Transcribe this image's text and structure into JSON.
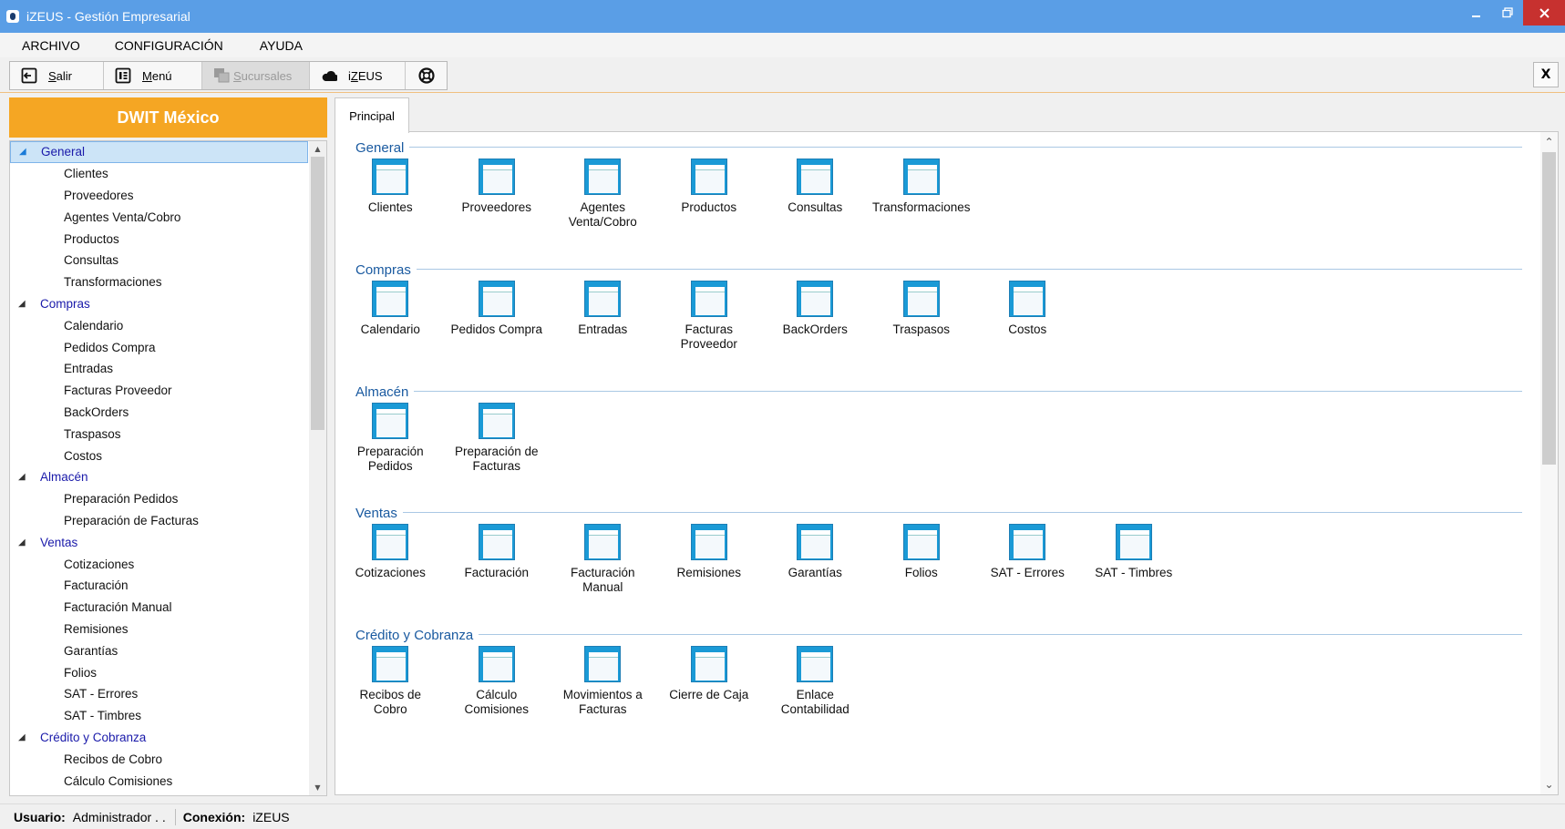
{
  "window": {
    "title": "iZEUS - Gestión Empresarial"
  },
  "menu": [
    "ARCHIVO",
    "CONFIGURACIÓN",
    "AYUDA"
  ],
  "toolbar": {
    "salir_u": "S",
    "salir_rest": "alir",
    "menu_u": "M",
    "menu_rest": "enú",
    "sucursales_u": "S",
    "sucursales_rest": "ucursales",
    "izeus_pre": "i",
    "izeus_u": "Z",
    "izeus_rest": "EUS",
    "close": "X"
  },
  "sidebar": {
    "company": "DWIT México",
    "tree": [
      {
        "label": "General",
        "children": [
          "Clientes",
          "Proveedores",
          "Agentes Venta/Cobro",
          "Productos",
          "Consultas",
          "Transformaciones"
        ]
      },
      {
        "label": "Compras",
        "children": [
          "Calendario",
          "Pedidos Compra",
          "Entradas",
          "Facturas Proveedor",
          "BackOrders",
          "Traspasos",
          "Costos"
        ]
      },
      {
        "label": "Almacén",
        "children": [
          "Preparación Pedidos",
          "Preparación de Facturas"
        ]
      },
      {
        "label": "Ventas",
        "children": [
          "Cotizaciones",
          "Facturación",
          "Facturación Manual",
          "Remisiones",
          "Garantías",
          "Folios",
          "SAT - Errores",
          "SAT - Timbres"
        ]
      },
      {
        "label": "Crédito y Cobranza",
        "children": [
          "Recibos de Cobro",
          "Cálculo Comisiones"
        ]
      }
    ]
  },
  "main": {
    "tab": "Principal",
    "sections": [
      {
        "title": "General",
        "items": [
          [
            "Clientes"
          ],
          [
            "Proveedores"
          ],
          [
            "Agentes",
            "Venta/Cobro"
          ],
          [
            "Productos"
          ],
          [
            "Consultas"
          ],
          [
            "Transformaciones"
          ]
        ]
      },
      {
        "title": "Compras",
        "items": [
          [
            "Calendario"
          ],
          [
            "Pedidos Compra"
          ],
          [
            "Entradas"
          ],
          [
            "Facturas",
            "Proveedor"
          ],
          [
            "BackOrders"
          ],
          [
            "Traspasos"
          ],
          [
            "Costos"
          ]
        ]
      },
      {
        "title": "Almacén",
        "items": [
          [
            "Preparación",
            "Pedidos"
          ],
          [
            "Preparación de",
            "Facturas"
          ]
        ]
      },
      {
        "title": "Ventas",
        "items": [
          [
            "Cotizaciones"
          ],
          [
            "Facturación"
          ],
          [
            "Facturación",
            "Manual"
          ],
          [
            "Remisiones"
          ],
          [
            "Garantías"
          ],
          [
            "Folios"
          ],
          [
            "SAT - Errores"
          ],
          [
            "SAT - Timbres"
          ]
        ]
      },
      {
        "title": "Crédito y Cobranza",
        "items": [
          [
            "Recibos de",
            "Cobro"
          ],
          [
            "Cálculo",
            "Comisiones"
          ],
          [
            "Movimientos a",
            "Facturas"
          ],
          [
            "Cierre de Caja"
          ],
          [
            "Enlace",
            "Contabilidad"
          ]
        ]
      }
    ]
  },
  "status": {
    "user_label": "Usuario:",
    "user_value": "Administrador . .",
    "conn_label": "Conexión:",
    "conn_value": "iZEUS"
  },
  "colors": {
    "titlebar": "#5a9ee6",
    "company": "#f5a623",
    "folder": "#1a9ad6",
    "link": "#1a1aaa"
  }
}
